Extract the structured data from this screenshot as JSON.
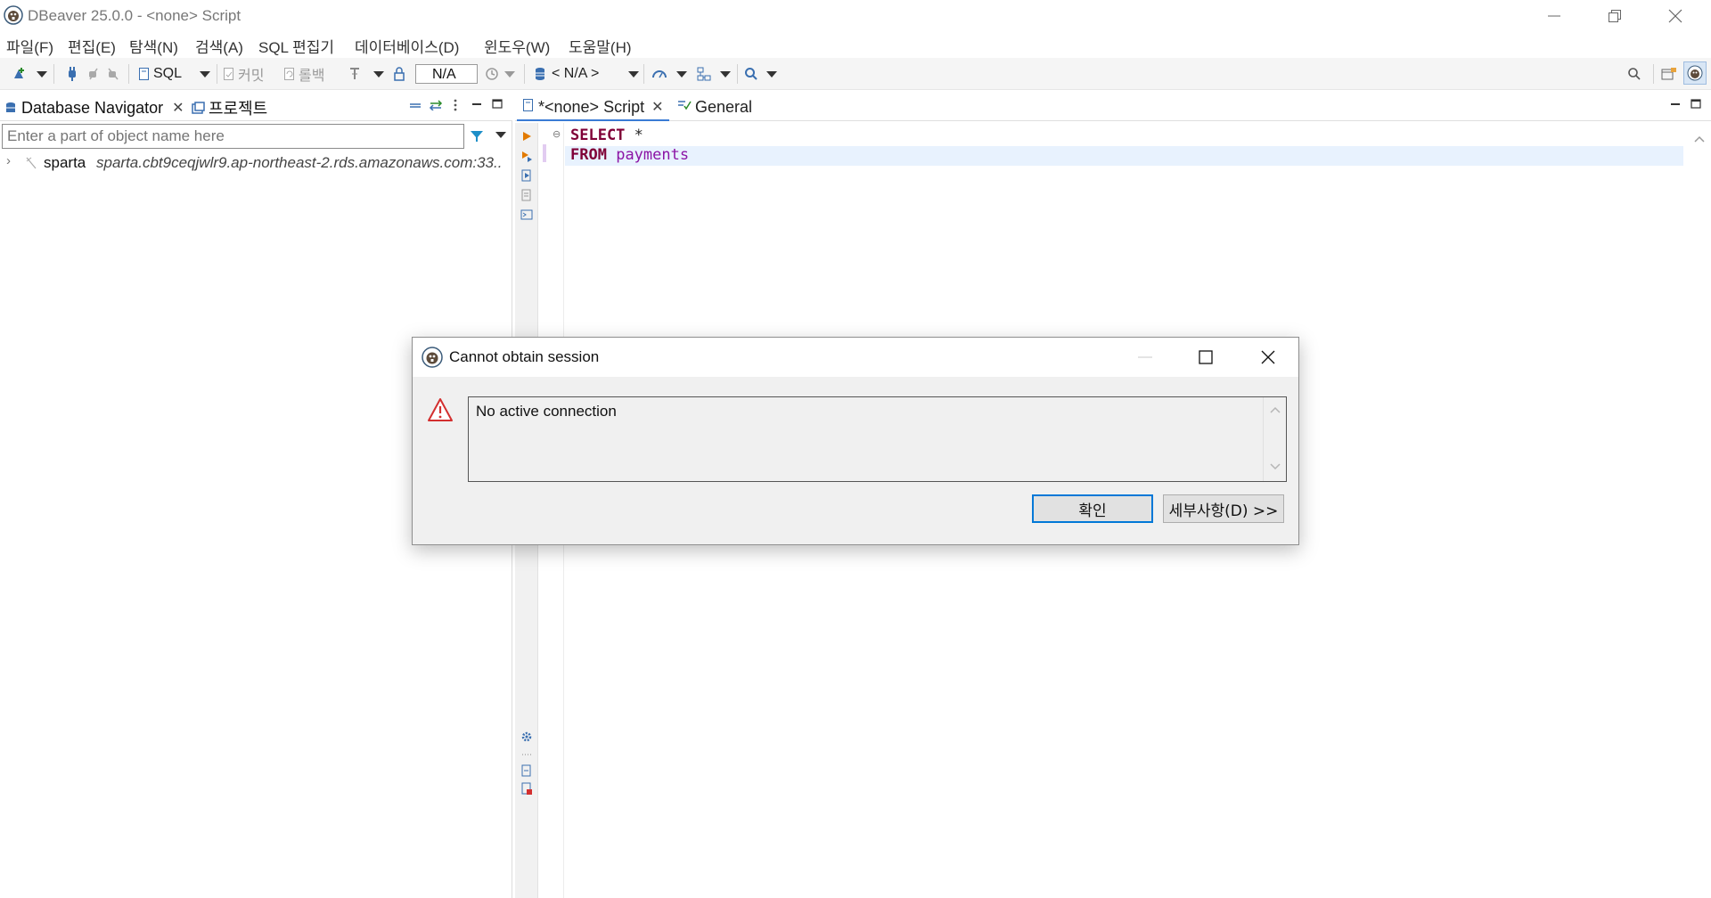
{
  "window": {
    "title": "DBeaver 25.0.0 - <none> Script"
  },
  "menu": {
    "items": [
      "파일(F)",
      "편집(E)",
      "탐색(N)",
      "검색(A)",
      "SQL 편집기",
      "데이터베이스(D)",
      "윈도우(W)",
      "도움말(H)"
    ]
  },
  "toolbar": {
    "sql_label": "SQL",
    "commit_label": "커밋",
    "rollback_label": "롤백",
    "transaction_value": "N/A",
    "datasource_label": "< N/A >"
  },
  "navigator": {
    "tab_label": "Database Navigator",
    "projects_tab_label": "프로젝트",
    "filter_placeholder": "Enter a part of object name here",
    "tree": [
      {
        "name": "sparta",
        "host": "sparta.cbt9ceqjwlr9.ap-northeast-2.rds.amazonaws.com:33.."
      }
    ]
  },
  "editor": {
    "tab_label": "*<none> Script",
    "general_tab_label": "General",
    "code": {
      "line1_kw": "SELECT",
      "line1_rest": " *",
      "line2_kw": "FROM",
      "line2_table": "payments"
    }
  },
  "dialog": {
    "title": "Cannot obtain session",
    "message": "No active connection",
    "ok_label": "확인",
    "details_label": "세부사항(D) >>"
  },
  "colors": {
    "keyword": "#7f0037",
    "table_name": "#8b14a5",
    "accent": "#0078d7",
    "warning": "#d32f2f"
  }
}
